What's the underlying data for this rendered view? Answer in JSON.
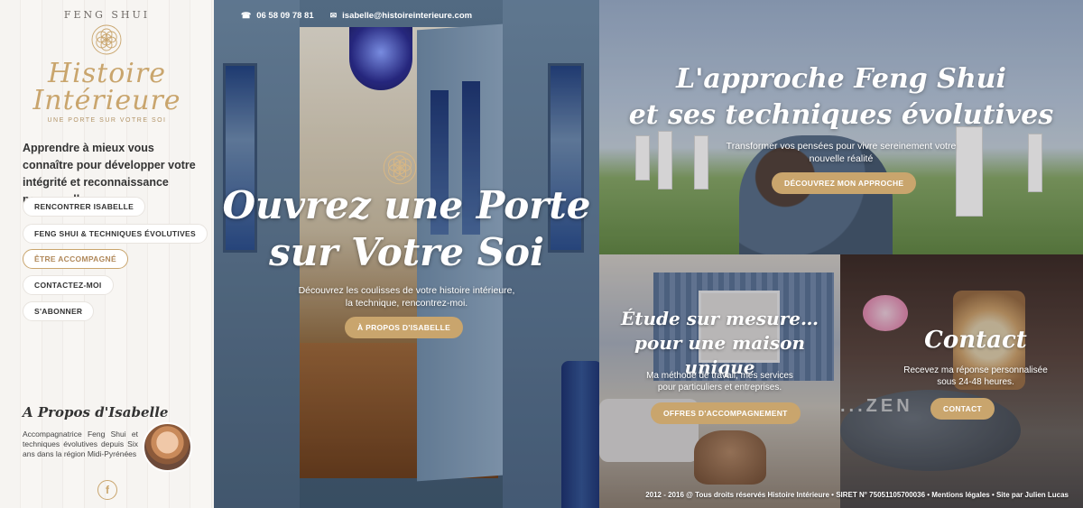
{
  "logo": {
    "kicker": "FENG SHUI",
    "line1": "Histoire",
    "line2": "Intérieure",
    "tagline": "UNE PORTE SUR VOTRE SOI",
    "icon": "flower-of-life-icon"
  },
  "sidebar": {
    "intro": "Apprendre à mieux vous connaître pour développer votre intégrité et reconnaissance personnelle.",
    "nav": [
      {
        "label": "RENCONTRER ISABELLE",
        "active": false
      },
      {
        "label": "FENG SHUI & TECHNIQUES ÉVOLUTIVES",
        "active": false
      },
      {
        "label": "ÊTRE ACCOMPAGNÉ",
        "active": true
      },
      {
        "label": "CONTACTEZ-MOI",
        "active": false
      },
      {
        "label": "S'ABONNER",
        "active": false
      }
    ],
    "about": {
      "title": "A Propos d'Isabelle",
      "text": "Accompagnatrice Feng Shui et techniques évolutives depuis Six ans dans la région Midi-Pyrénées"
    },
    "social": {
      "facebook_label": "f"
    }
  },
  "contact_bar": {
    "phone": "06 58 09 78 81",
    "email": "isabelle@histoireinterieure.com",
    "phone_icon": "phone-icon",
    "email_icon": "mail-icon"
  },
  "hero": {
    "title_line1": "Ouvrez une Porte",
    "title_line2": "sur Votre Soi",
    "text_line1": "Découvrez les coulisses de votre histoire intérieure,",
    "text_line2": "la technique, rencontrez-moi.",
    "button": "À PROPOS D'ISABELLE"
  },
  "approach": {
    "title_line1": "L'approche Feng Shui",
    "title_line2": "et ses techniques évolutives",
    "text_line1": "Transformer vos pensées pour vivre sereinement votre",
    "text_line2": "nouvelle réalité",
    "button": "DÉCOUVREZ MON APPROCHE"
  },
  "study": {
    "title_line1": "Étude sur mesure…",
    "title_line2": "pour une maison unique",
    "text_line1": "Ma méthode de travail, mes services",
    "text_line2": "pour particuliers et entreprises.",
    "button": "OFFRES D'ACCOMPAGNEMENT"
  },
  "contact": {
    "title": "Contact",
    "text_line1": "Recevez ma réponse personnalisée",
    "text_line2": "sous 24-48 heures.",
    "button": "CONTACT",
    "stone_text": "...ZEN"
  },
  "footer": "2012 - 2016 @ Tous droits réservés Histoire Intérieure • SIRET N° 75051105700036 • Mentions légales • Site par Julien Lucas",
  "colors": {
    "accent": "#c9a56d",
    "text": "#333333"
  }
}
